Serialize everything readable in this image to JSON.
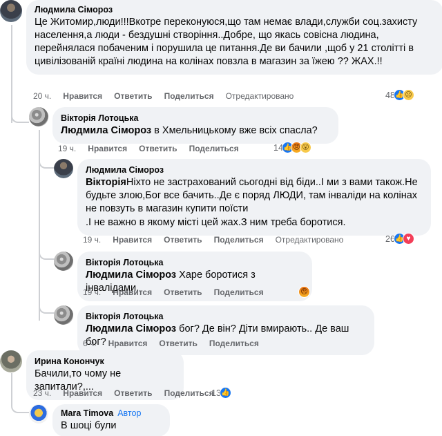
{
  "comments": [
    {
      "author": "Людмила Сімороз",
      "text": "Це Житомир,люди!!!Вкотре переконуюся,що там немає влади,служби соц.захисту населення,а люди - бездушні створіння..Добре, що якась совісна людина, перейнялася побаченим і порушила це питання.Де ви бачили ,щоб у 21 столітті в цивілізованій країні людина на колінах повзла в магазин за їжею ?? ЖАХ.!!",
      "time": "20 ч.",
      "like": "Нравится",
      "reply": "Ответить",
      "share": "Поделиться",
      "edited": "Отредактировано",
      "reactions_count": "48"
    },
    {
      "author": "Вікторія Лотоцька",
      "mention": "Людмила Сімороз",
      "text": " в Хмельницькому вже всіх спасла?",
      "time": "19 ч.",
      "like": "Нравится",
      "reply": "Ответить",
      "share": "Поделиться",
      "reactions_count": "14"
    },
    {
      "author": "Людмила Сімороз",
      "mention": "Вікторія",
      "text": "Ніхто не застрахований сьогодні від біди..І ми з вами також.Не будьте злою,Бог все бачить..Де є поряд ЛЮДИ, там інваліди на колінах не повзуть в магазин купити поїсти",
      "text2": ".І не важно в якому місті цей жах.З ним треба боротися.",
      "time": "19 ч.",
      "like": "Нравится",
      "reply": "Ответить",
      "share": "Поделиться",
      "edited": "Отредактировано",
      "reactions_count": "26"
    },
    {
      "author": "Вікторія Лотоцька",
      "mention": "Людмила Сімороз",
      "text": " Харе боротися з інвалідами.",
      "time": "19 ч.",
      "like": "Нравится",
      "reply": "Ответить",
      "share": "Поделиться"
    },
    {
      "author": "Вікторія Лотоцька",
      "mention": "Людмила Сімороз",
      "text": " бог? Де він? Діти вмирають.. Де ваш бог?",
      "time": "6 ч.",
      "like": "Нравится",
      "reply": "Ответить",
      "share": "Поделиться"
    },
    {
      "author": "Ирина Конончук",
      "text": "Бачили,то чому не запитали?,...",
      "time": "23 ч.",
      "like": "Нравится",
      "reply": "Ответить",
      "share": "Поделиться",
      "reactions_count": "13"
    },
    {
      "author": "Mara Timova",
      "author_tag": "Автор",
      "text": "В шоці були"
    }
  ],
  "colors": {
    "bubble": "#f0f2f5",
    "meta": "#65676b",
    "link": "#1877f2",
    "thread_line": "#ced0d4"
  }
}
